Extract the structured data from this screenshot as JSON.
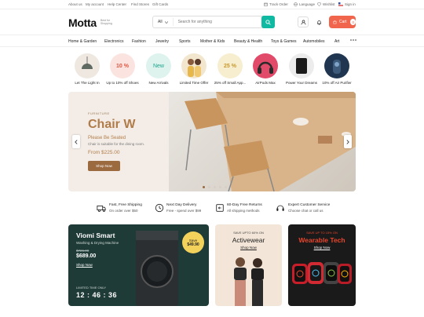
{
  "topbar": {
    "links": [
      "About us",
      "My account",
      "Help Center",
      "Find Stores",
      "Gift Cards"
    ],
    "track_order": "Track Order",
    "language": "Language",
    "wishlist": "Wishlist",
    "sign_in": "Sign in"
  },
  "header": {
    "logo": "Motta",
    "logo_tag": "Best for Shopping",
    "search_category": "All",
    "search_placeholder": "Search for anything",
    "cart_label": "Cart",
    "cart_count": "0"
  },
  "nav": {
    "items": [
      "Home & Garden",
      "Electronics",
      "Fashion",
      "Jewelry",
      "Sports",
      "Mother & Kids",
      "Beauty & Health",
      "Toys & Games",
      "Automobiles",
      "Art"
    ],
    "more_icon": "more-dots-icon"
  },
  "categories": [
    {
      "label": "Let The Light In",
      "badge": ""
    },
    {
      "label": "Up to 10% off Shoes",
      "badge": "10 %"
    },
    {
      "label": "New Arrivals",
      "badge": "New"
    },
    {
      "label": "Limited Time Offer",
      "badge": ""
    },
    {
      "label": "25% off Small App...",
      "badge": "25 %"
    },
    {
      "label": "AirPods Max",
      "badge": ""
    },
    {
      "label": "Power Your Dreams",
      "badge": ""
    },
    {
      "label": "10% off Air Purifier",
      "badge": ""
    }
  ],
  "hero": {
    "kicker": "FURNITURE",
    "title": "Chair W",
    "subtitle": "Please Be Seated",
    "description": "Chair is suitable for the dining room.",
    "price": "From $225.00",
    "button": "Shop Now",
    "slides": 5,
    "active_slide": 1
  },
  "features": [
    {
      "title": "Fast, Free Shipping",
      "sub": "On order over $50",
      "icon": "truck-icon"
    },
    {
      "title": "Next Day Delivery",
      "sub": "Free - spend over $99",
      "icon": "clock-icon"
    },
    {
      "title": "60-Day Free Returns",
      "sub": "All shipping methods",
      "icon": "return-icon"
    },
    {
      "title": "Expert Customer Service",
      "sub": "Choose chat or call us",
      "icon": "headset-icon"
    }
  ],
  "promos": {
    "viomi": {
      "title": "Viomi Smart",
      "sub": "Washing & Drying Machine",
      "old_price": "$726.00",
      "price": "$689.00",
      "link": "Shop Now",
      "save_label": "Save",
      "save_amount": "$49.90",
      "timer_label": "LIMITED TIME ONLY",
      "timer": "12 : 46 : 36"
    },
    "activewear": {
      "kicker": "SAVE UPTO 60% ON",
      "title": "Activewear",
      "link": "Shop Now"
    },
    "wearable": {
      "kicker": "SAVE UP TO 15% ON",
      "title": "Wearable Tech",
      "link": "Shop Now"
    }
  },
  "colors": {
    "accent_teal": "#10b9a1",
    "cart_orange": "#f0654b",
    "hero_brown": "#b07c4a",
    "viomi_green": "#1f3b37",
    "wearable_red": "#e8452c"
  }
}
